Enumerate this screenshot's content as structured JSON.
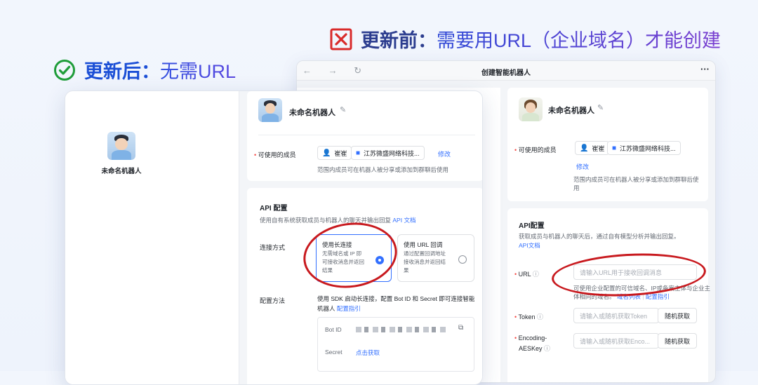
{
  "headlines": {
    "before": {
      "strong": "更新前：",
      "rest": "需要用URL（企业域名）才能创建"
    },
    "after": {
      "strong": "更新后：",
      "rest": "无需URL"
    }
  },
  "old_window": {
    "title": "创建智能机器人",
    "nav_symbols": "← → ↻",
    "more": "···",
    "bot_name": "未命名机器人",
    "members_label": "可使用的成员",
    "member_user": "崔崔",
    "member_org": "江苏微盛网络科技...",
    "modify": "修改",
    "members_hint": "范围内成员可在机器人被分享或添加到群聊后使",
    "members_hint_2": "用",
    "api_title": "API配置",
    "api_desc": "获取成员与机器人的聊天后，通过自有模型分析并输出回复。",
    "api_doc": "API文档",
    "url_label": "URL",
    "url_placeholder": "请输入URL用于接收回调消息",
    "url_hint_1": "可使用企业配置的可信域名、IP或备案主体与企业主",
    "url_hint_2": "体相同的域名。",
    "domain_list": "域名列表",
    "config_guide": "配置指引",
    "token_label": "Token",
    "token_placeholder": "请输入或随机获取Token",
    "random_get": "随机获取",
    "aes_label_1": "Encoding-",
    "aes_label_2": "AESKey",
    "aes_placeholder": "请输入或随机获取Enco...",
    "random_get_2": "随机获取"
  },
  "new_window": {
    "sidebar_name": "未命名机器人",
    "bot_name": "未命名机器人",
    "members_label": "可使用的成员",
    "member_user": "崔崔",
    "member_org": "江苏微盛网络科技...",
    "modify": "修改",
    "members_hint": "范围内成员可在机器人被分享或添加到群聊后使用",
    "api_title": "API 配置",
    "api_desc": "使用自有系统获取成员与机器人的聊天并输出回复",
    "api_doc": "API 文档",
    "conn_label": "连接方式",
    "opt1_title": "使用长连接",
    "opt1_desc_1": "无需域名或 IP 即",
    "opt1_desc_2": "可接收消息并返回",
    "opt1_desc_3": "结果",
    "opt2_title": "使用 URL 回调",
    "opt2_desc_1": "通过配置回调地址",
    "opt2_desc_2": "接收消息并返回结",
    "opt2_desc_3": "果",
    "config_label": "配置方法",
    "config_desc_1": "使用 SDK 启动长连接，配置 Bot ID 和 Secret 即可连接智能",
    "config_desc_2": "机器人",
    "config_guide": "配置指引",
    "bot_id_label": "Bot ID",
    "secret_label": "Secret",
    "click_get": "点击获取"
  },
  "colors": {
    "accent": "#3370ff",
    "red": "#c8191e",
    "green": "#1f9d3a"
  }
}
